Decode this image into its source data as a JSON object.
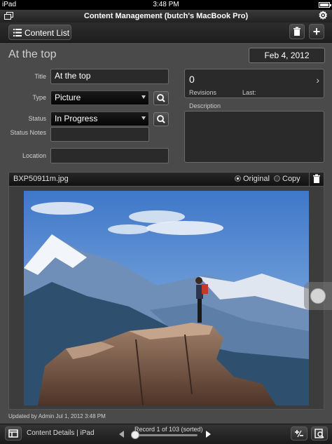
{
  "status_bar": {
    "device": "iPad",
    "time": "3:48 PM"
  },
  "title_bar": {
    "title": "Content Management (butch's MacBook Pro)"
  },
  "toolbar": {
    "content_list_label": "Content List"
  },
  "record": {
    "heading": "At the top",
    "date": "Feb 4, 2012",
    "fields": {
      "title_label": "Title",
      "title_value": "At the top",
      "type_label": "Type",
      "type_value": "Picture",
      "status_label": "Status",
      "status_value": "In Progress",
      "status_notes_label": "Status Notes",
      "location_label": "Location"
    },
    "revisions": {
      "count": "0",
      "label": "Revisions",
      "last_label": "Last:"
    },
    "description_label": "Description"
  },
  "image": {
    "filename": "BXP50911m.jpg",
    "option_original": "Original",
    "option_copy": "Copy",
    "selected": "Original"
  },
  "updated_text": "Updated by Admin Jul 1, 2012 3:48 PM",
  "bottom_bar": {
    "layout_name": "Content Details | iPad",
    "record_status": "Record 1 of 103 (sorted)"
  }
}
